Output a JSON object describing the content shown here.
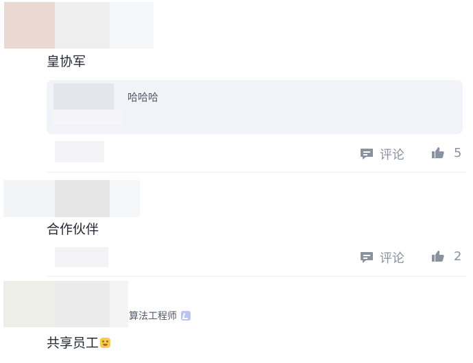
{
  "comments": [
    {
      "author": "皇协军",
      "quote": "哈哈哈",
      "actions": {
        "comment_label": "评论",
        "like_count": "5"
      }
    },
    {
      "author": "合作伙伴",
      "actions": {
        "comment_label": "评论",
        "like_count": "2"
      }
    },
    {
      "job_title": "算法工程师",
      "author": "共享员工",
      "badge_icon": "level-badge-icon",
      "emoji_icon": "smiley-emoji-icon"
    }
  ],
  "colors": {
    "text_primary": "#252933",
    "text_secondary": "#8a919f",
    "quote_background": "#f2f3f8",
    "icon_gray": "#8a919f"
  }
}
